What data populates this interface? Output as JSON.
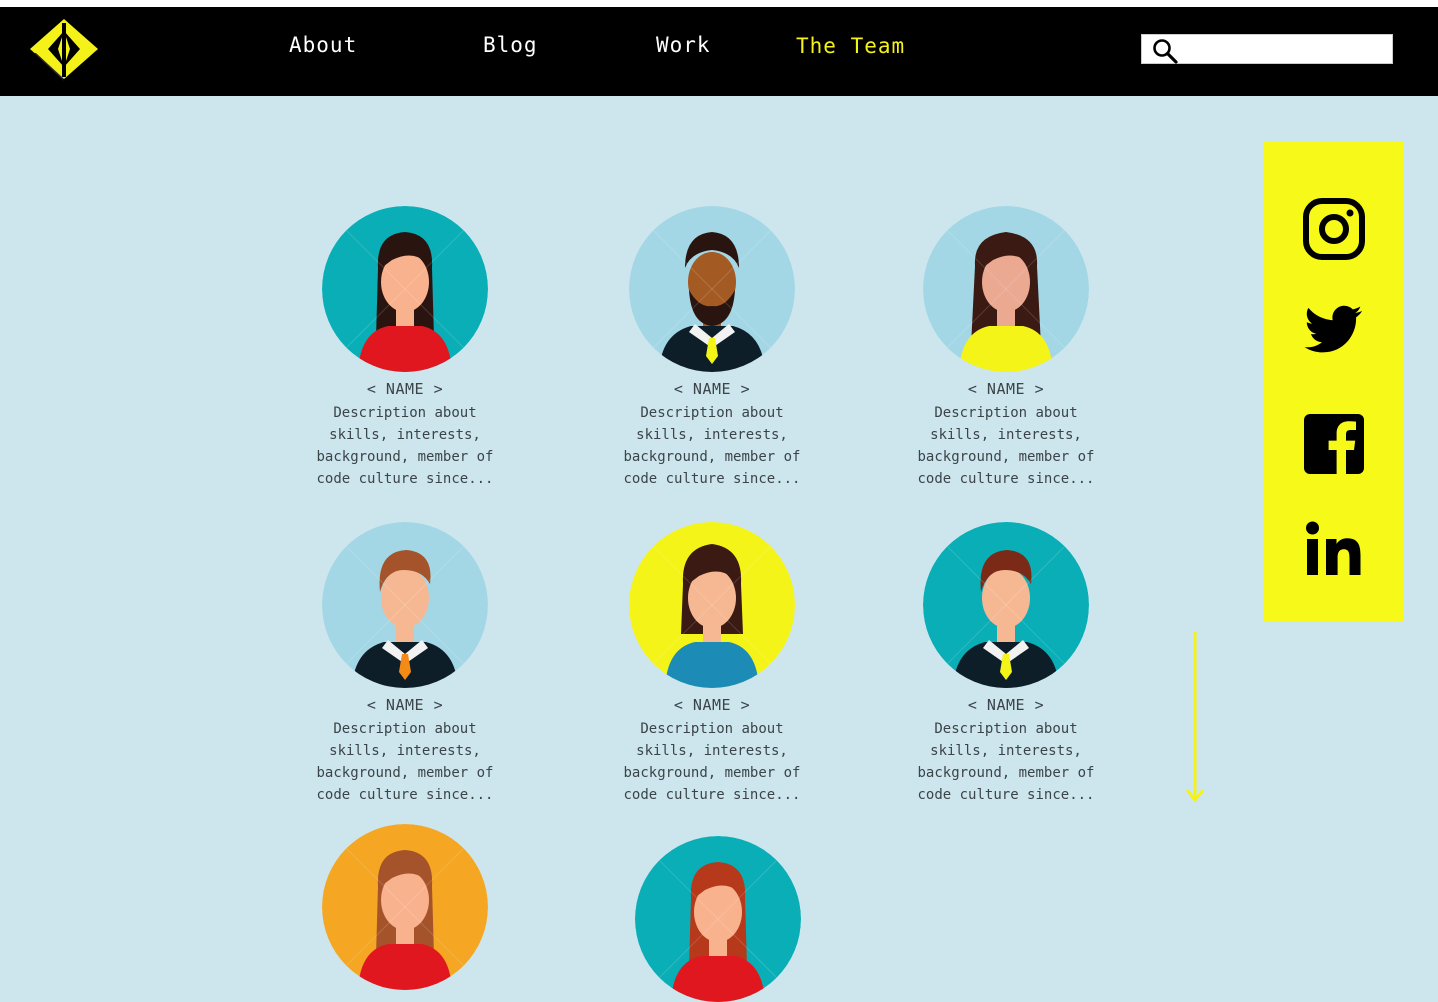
{
  "nav": {
    "links": [
      "About",
      "Blog",
      "Work",
      "The Team"
    ],
    "active": "The Team"
  },
  "search": {
    "placeholder": "",
    "value": ""
  },
  "members": [
    {
      "name": "< NAME >",
      "description": "Description about skills, interests, background, member of code culture since...",
      "bg": "#0aaeb6",
      "gender": "female",
      "shirt": "#e0171f",
      "skin": "#f9b28e",
      "hair": "#2a1410"
    },
    {
      "name": "< NAME >",
      "description": "Description about skills, interests, background, member of code culture since...",
      "bg": "#a3d7e5",
      "gender": "male-beard",
      "shirt": "#0e1e29",
      "skin": "#a45a23",
      "hair": "#2a1410"
    },
    {
      "name": "< NAME >",
      "description": "Description about skills, interests, background, member of code culture since...",
      "bg": "#a3d7e5",
      "gender": "female-long",
      "shirt": "#f5f418",
      "skin": "#eaa990",
      "hair": "#3a1a12"
    },
    {
      "name": "< NAME >",
      "description": "Description about skills, interests, background, member of code culture since...",
      "bg": "#a3d7e5",
      "gender": "male",
      "shirt": "#0e1e29",
      "skin": "#f6b893",
      "hair": "#a5532a",
      "tie": "#f58b17"
    },
    {
      "name": "< NAME >",
      "description": "Description about skills, interests, background, member of code culture since...",
      "bg": "#f5f418",
      "gender": "female-bob",
      "shirt": "#1c8cb6",
      "skin": "#f6b893",
      "hair": "#3a1a12"
    },
    {
      "name": "< NAME >",
      "description": "Description about skills, interests, background, member of code culture since...",
      "bg": "#0aaeb6",
      "gender": "male",
      "shirt": "#0e1e29",
      "skin": "#f6b893",
      "hair": "#7a2a16",
      "tie": "#f5f418"
    },
    {
      "name": "",
      "description": "",
      "bg": "#f5a623",
      "gender": "female",
      "shirt": "#e0171f",
      "skin": "#f9b28e",
      "hair": "#a5532a"
    },
    {
      "name": "",
      "description": "",
      "bg": "#0aaeb6",
      "gender": "female",
      "shirt": "#e0171f",
      "skin": "#f9b28e",
      "hair": "#b5391a"
    }
  ],
  "social": [
    "instagram-icon",
    "twitter-icon",
    "facebook-icon",
    "linkedin-icon"
  ],
  "colors": {
    "accent": "#f5f21a",
    "page_bg": "#cde6ee",
    "nav_bg": "#000000"
  }
}
